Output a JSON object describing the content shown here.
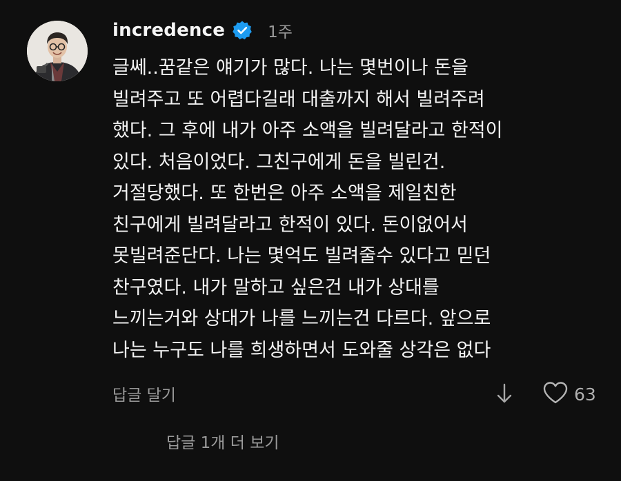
{
  "comment": {
    "username": "incredence",
    "verified": true,
    "time_ago": "1주",
    "lines": [
      "글쎄..꿈같은 얘기가 많다. 나는 몇번이나 돈을",
      "빌려주고 또 어렵다길래 대출까지 해서 빌려주려",
      "했다. 그 후에 내가 아주 소액을 빌려달라고 한적이",
      "있다. 처음이었다. 그친구에게 돈을 빌린건.",
      "거절당했다. 또 한번은 아주 소액을 제일친한",
      "친구에게 빌려달라고 한적이 있다. 돈이없어서",
      "못빌려준단다. 나는 몇억도 빌려줄수 있다고 믿던",
      "찬구였다. 내가 말하고 싶은건 내가 상대를",
      "느끼는거와 상대가 나를 느끼는건 다르다. 앞으로",
      "나는 누구도 나를 희생하면서 도와줄 상각은 없다"
    ],
    "reply_label": "답글 달기",
    "like_count": "63",
    "more_replies_label": "답글 1개 더 보기"
  },
  "icons": {
    "verified": "verified-badge-icon",
    "down": "arrow-down-icon",
    "like": "heart-icon"
  },
  "colors": {
    "background": "#0f0f0f",
    "text": "#f3f3f3",
    "muted": "#9a9a9a",
    "verified": "#1d9bf0"
  }
}
